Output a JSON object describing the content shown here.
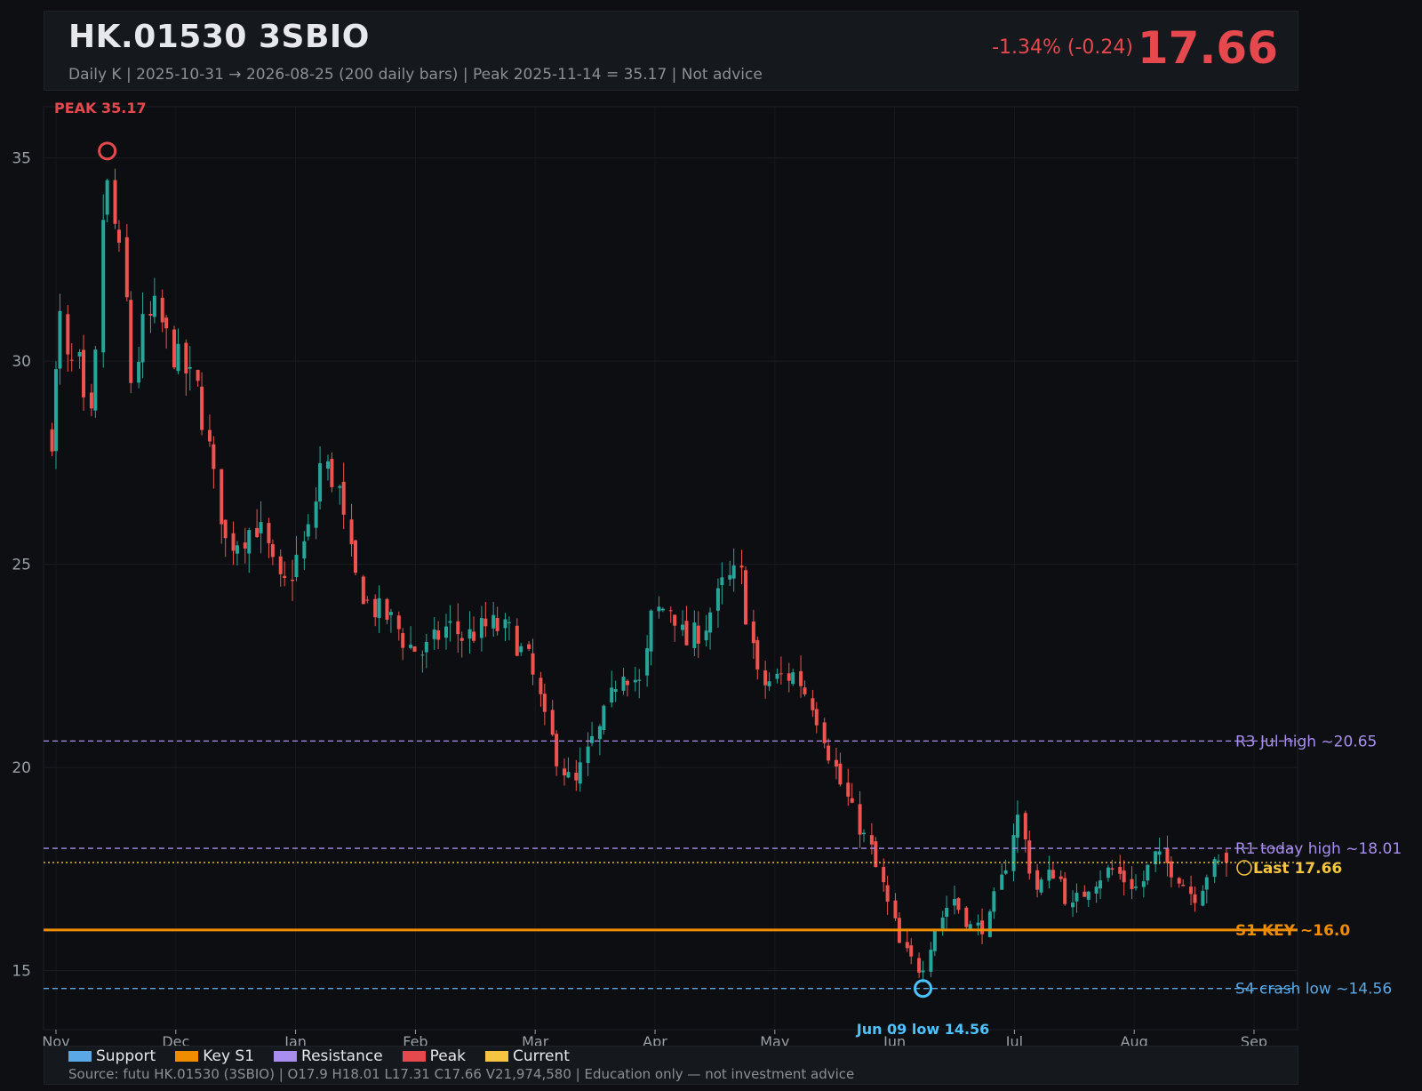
{
  "header": {
    "title": "HK.01530  3SBIO",
    "subtitle": "Daily K  |  2025-10-31 → 2026-08-25 (200 daily bars)  |  Peak 2025-11-14 = 35.17  |  Not advice",
    "change": "-1.34%  (-0.24)",
    "price": "17.66"
  },
  "legend": {
    "items": [
      {
        "label": "Support",
        "color": "#5aa9e6"
      },
      {
        "label": "Key S1",
        "color": "#f08c00"
      },
      {
        "label": "Resistance",
        "color": "#a98ef0"
      },
      {
        "label": "Peak",
        "color": "#e5484d"
      },
      {
        "label": "Current",
        "color": "#f5c542"
      }
    ],
    "source": "Source: futu HK.01530 (3SBIO)  |  O17.9  H18.01  L17.31  C17.66  V21,974,580  |  Education only — not investment advice"
  },
  "chart_data": {
    "type": "candlestick",
    "ylim": [
      13.5,
      36.2
    ],
    "y_ticks": [
      "15",
      "20",
      "25",
      "30",
      "35"
    ],
    "x_ticks": [
      "Nov",
      "Dec",
      "Jan",
      "Feb",
      "Mar",
      "Apr",
      "May",
      "Jun",
      "Jul",
      "Aug",
      "Sep"
    ],
    "up_color": "#26a69a",
    "down_color": "#ef5350",
    "close_points": [
      [
        "2025-10-31",
        28.2
      ],
      [
        "2025-11-03",
        31.0
      ],
      [
        "2025-11-05",
        29.5
      ],
      [
        "2025-11-07",
        30.2
      ],
      [
        "2025-11-10",
        28.0
      ],
      [
        "2025-11-12",
        30.0
      ],
      [
        "2025-11-14",
        34.8
      ],
      [
        "2025-11-17",
        33.0
      ],
      [
        "2025-11-19",
        32.0
      ],
      [
        "2025-11-21",
        29.5
      ],
      [
        "2025-11-24",
        30.8
      ],
      [
        "2025-11-27",
        31.2
      ],
      [
        "2025-12-01",
        30.3
      ],
      [
        "2025-12-04",
        29.8
      ],
      [
        "2025-12-08",
        29.2
      ],
      [
        "2025-12-11",
        27.5
      ],
      [
        "2025-12-15",
        25.5
      ],
      [
        "2025-12-19",
        25.7
      ],
      [
        "2025-12-23",
        26.0
      ],
      [
        "2025-12-29",
        24.3
      ],
      [
        "2026-01-05",
        25.8
      ],
      [
        "2026-01-08",
        27.5
      ],
      [
        "2026-01-12",
        27.0
      ],
      [
        "2026-01-16",
        24.8
      ],
      [
        "2026-01-20",
        24.0
      ],
      [
        "2026-01-26",
        23.6
      ],
      [
        "2026-01-30",
        23.0
      ],
      [
        "2026-02-03",
        22.8
      ],
      [
        "2026-02-09",
        23.5
      ],
      [
        "2026-02-13",
        23.2
      ],
      [
        "2026-02-20",
        23.5
      ],
      [
        "2026-02-25",
        23.3
      ],
      [
        "2026-03-02",
        22.5
      ],
      [
        "2026-03-06",
        21.0
      ],
      [
        "2026-03-10",
        20.0
      ],
      [
        "2026-03-13",
        19.5
      ],
      [
        "2026-03-17",
        20.5
      ],
      [
        "2026-03-20",
        21.0
      ],
      [
        "2026-03-25",
        22.5
      ],
      [
        "2026-03-30",
        22.0
      ],
      [
        "2026-04-02",
        23.8
      ],
      [
        "2026-04-07",
        24.0
      ],
      [
        "2026-04-10",
        23.0
      ],
      [
        "2026-04-15",
        23.5
      ],
      [
        "2026-04-20",
        24.5
      ],
      [
        "2026-04-24",
        24.8
      ],
      [
        "2026-04-29",
        22.0
      ],
      [
        "2026-05-04",
        22.2
      ],
      [
        "2026-05-08",
        22.3
      ],
      [
        "2026-05-13",
        21.5
      ],
      [
        "2026-05-18",
        20.0
      ],
      [
        "2026-05-22",
        19.0
      ],
      [
        "2026-05-27",
        18.0
      ],
      [
        "2026-06-01",
        16.5
      ],
      [
        "2026-06-04",
        15.5
      ],
      [
        "2026-06-09",
        15.0
      ],
      [
        "2026-06-12",
        16.0
      ],
      [
        "2026-06-17",
        16.8
      ],
      [
        "2026-06-22",
        16.0
      ],
      [
        "2026-06-26",
        16.2
      ],
      [
        "2026-07-01",
        17.8
      ],
      [
        "2026-07-03",
        19.0
      ],
      [
        "2026-07-08",
        17.0
      ],
      [
        "2026-07-13",
        17.5
      ],
      [
        "2026-07-17",
        16.5
      ],
      [
        "2026-07-22",
        17.2
      ],
      [
        "2026-07-27",
        17.5
      ],
      [
        "2026-08-03",
        17.0
      ],
      [
        "2026-08-07",
        17.8
      ],
      [
        "2026-08-12",
        17.5
      ],
      [
        "2026-08-17",
        16.8
      ],
      [
        "2026-08-21",
        17.5
      ],
      [
        "2026-08-25",
        17.66
      ]
    ],
    "levels": [
      {
        "label": "R3 Jul high ~20.65",
        "value": 20.65,
        "color": "#a98ef0",
        "style": "dashed"
      },
      {
        "label": "R1 today high ~18.01",
        "value": 18.01,
        "color": "#a98ef0",
        "style": "dashed"
      },
      {
        "label": "Last 17.66",
        "value": 17.66,
        "color": "#f5c542",
        "style": "dotted"
      },
      {
        "label": "S1 KEY ~16.0",
        "value": 16.0,
        "color": "#f08c00",
        "style": "solid"
      },
      {
        "label": "S4 crash low ~14.56",
        "value": 14.56,
        "color": "#5aa9e6",
        "style": "dashed"
      }
    ],
    "markers": [
      {
        "label": "PEAK 35.17",
        "date": "2025-11-14",
        "value": 35.17,
        "color": "#e5484d"
      },
      {
        "label": "Jun 09 low 14.56",
        "date": "2026-06-09",
        "value": 14.56,
        "color": "#4cc2ff"
      }
    ]
  }
}
